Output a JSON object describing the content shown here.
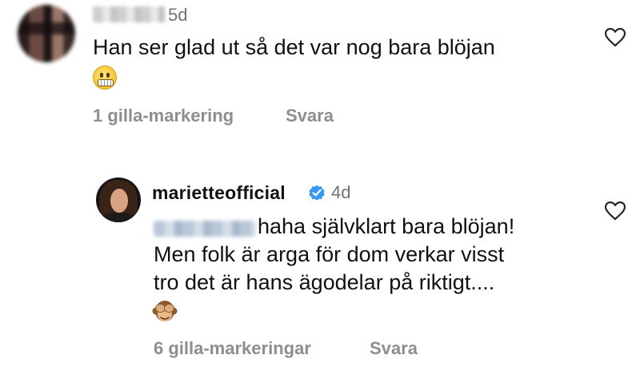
{
  "comment1": {
    "timestamp": "5d",
    "text": "Han ser glad ut så det var nog bara blöjan",
    "emoji": "grimacing-face",
    "likes": "1 gilla-markering",
    "reply_label": "Svara"
  },
  "comment2": {
    "username": "mariettеofficial",
    "verified": true,
    "timestamp": "4d",
    "text_lines": [
      "haha självklart bara blöjan!",
      "Men folk är arga för dom verkar visst",
      "tro det är hans ägodelar på riktigt...."
    ],
    "emoji": "see-no-evil-monkey",
    "likes": "6 gilla-markeringar",
    "reply_label": "Svara"
  },
  "colors": {
    "text": "#111111",
    "muted": "#8e8e8e",
    "timestamp": "#737373",
    "verified": "#3897f0"
  }
}
